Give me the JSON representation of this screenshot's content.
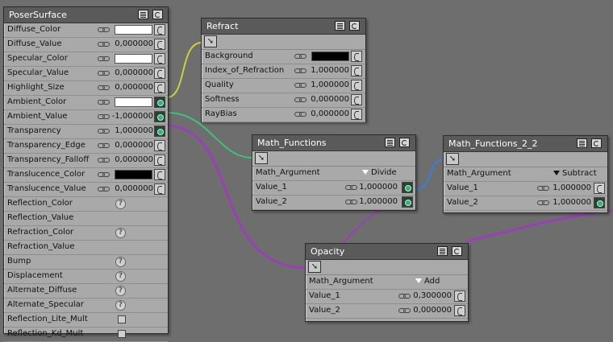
{
  "colors": {
    "wire_yellow": "#c8d23a",
    "wire_green": "#3ec27a",
    "wire_purple": "#9a3fb8",
    "wire_blue": "#3b7fd6",
    "node_bg": "#a9a9a9",
    "header_bg": "#5a5a5a"
  },
  "poser_surface": {
    "title": "PoserSurface",
    "rows": [
      {
        "label": "Diffuse_Color",
        "kind": "color",
        "color": "#ffffff"
      },
      {
        "label": "Diffuse_Value",
        "kind": "value",
        "value": "0,000000"
      },
      {
        "label": "Specular_Color",
        "kind": "color",
        "color": "#ffffff"
      },
      {
        "label": "Specular_Value",
        "kind": "value",
        "value": "0,000000"
      },
      {
        "label": "Highlight_Size",
        "kind": "value",
        "value": "0,000000"
      },
      {
        "label": "Ambient_Color",
        "kind": "color",
        "color": "#ffffff",
        "connected": true
      },
      {
        "label": "Ambient_Value",
        "kind": "value",
        "value": "-1,000000",
        "connected": true
      },
      {
        "label": "Transparency",
        "kind": "value",
        "value": "1,000000",
        "connected": true
      },
      {
        "label": "Transparency_Edge",
        "kind": "value",
        "value": "0,000000"
      },
      {
        "label": "Transparency_Falloff",
        "kind": "value",
        "value": "0,000000"
      },
      {
        "label": "Translucence_Color",
        "kind": "color",
        "color": "#000000"
      },
      {
        "label": "Translucence_Value",
        "kind": "value",
        "value": "0,000000"
      },
      {
        "label": "Reflection_Color",
        "kind": "help"
      },
      {
        "label": "Reflection_Value",
        "kind": "none"
      },
      {
        "label": "Refraction_Color",
        "kind": "help"
      },
      {
        "label": "Refraction_Value",
        "kind": "none"
      },
      {
        "label": "Bump",
        "kind": "help"
      },
      {
        "label": "Displacement",
        "kind": "help"
      },
      {
        "label": "Alternate_Diffuse",
        "kind": "help"
      },
      {
        "label": "Alternate_Specular",
        "kind": "help"
      },
      {
        "label": "Reflection_Lite_Mult",
        "kind": "check"
      },
      {
        "label": "Reflection_Kd_Mult",
        "kind": "check"
      }
    ]
  },
  "refract": {
    "title": "Refract",
    "rows": [
      {
        "label": "Background",
        "kind": "color",
        "color": "#000000"
      },
      {
        "label": "Index_of_Refraction",
        "kind": "value",
        "value": "1,000000"
      },
      {
        "label": "Quality",
        "kind": "value",
        "value": "1,000000"
      },
      {
        "label": "Softness",
        "kind": "value",
        "value": "0,000000"
      },
      {
        "label": "RayBias",
        "kind": "value",
        "value": "0,000000"
      }
    ]
  },
  "math_functions": {
    "title": "Math_Functions",
    "argument_label": "Math_Argument",
    "argument_value": "Divide",
    "rows": [
      {
        "label": "Value_1",
        "value": "1,000000",
        "connected": true
      },
      {
        "label": "Value_2",
        "value": "1,000000",
        "connected": true
      }
    ]
  },
  "math_functions_2_2": {
    "title": "Math_Functions_2_2",
    "argument_label": "Math_Argument",
    "argument_value": "Subtract",
    "rows": [
      {
        "label": "Value_1",
        "value": "1,000000",
        "connected": false
      },
      {
        "label": "Value_2",
        "value": "1,000000",
        "connected": true
      }
    ]
  },
  "opacity": {
    "title": "Opacity",
    "argument_label": "Math_Argument",
    "argument_value": "Add",
    "rows": [
      {
        "label": "Value_1",
        "value": "0,300000",
        "connected": false
      },
      {
        "label": "Value_2",
        "value": "0,000000",
        "connected": false
      }
    ]
  }
}
